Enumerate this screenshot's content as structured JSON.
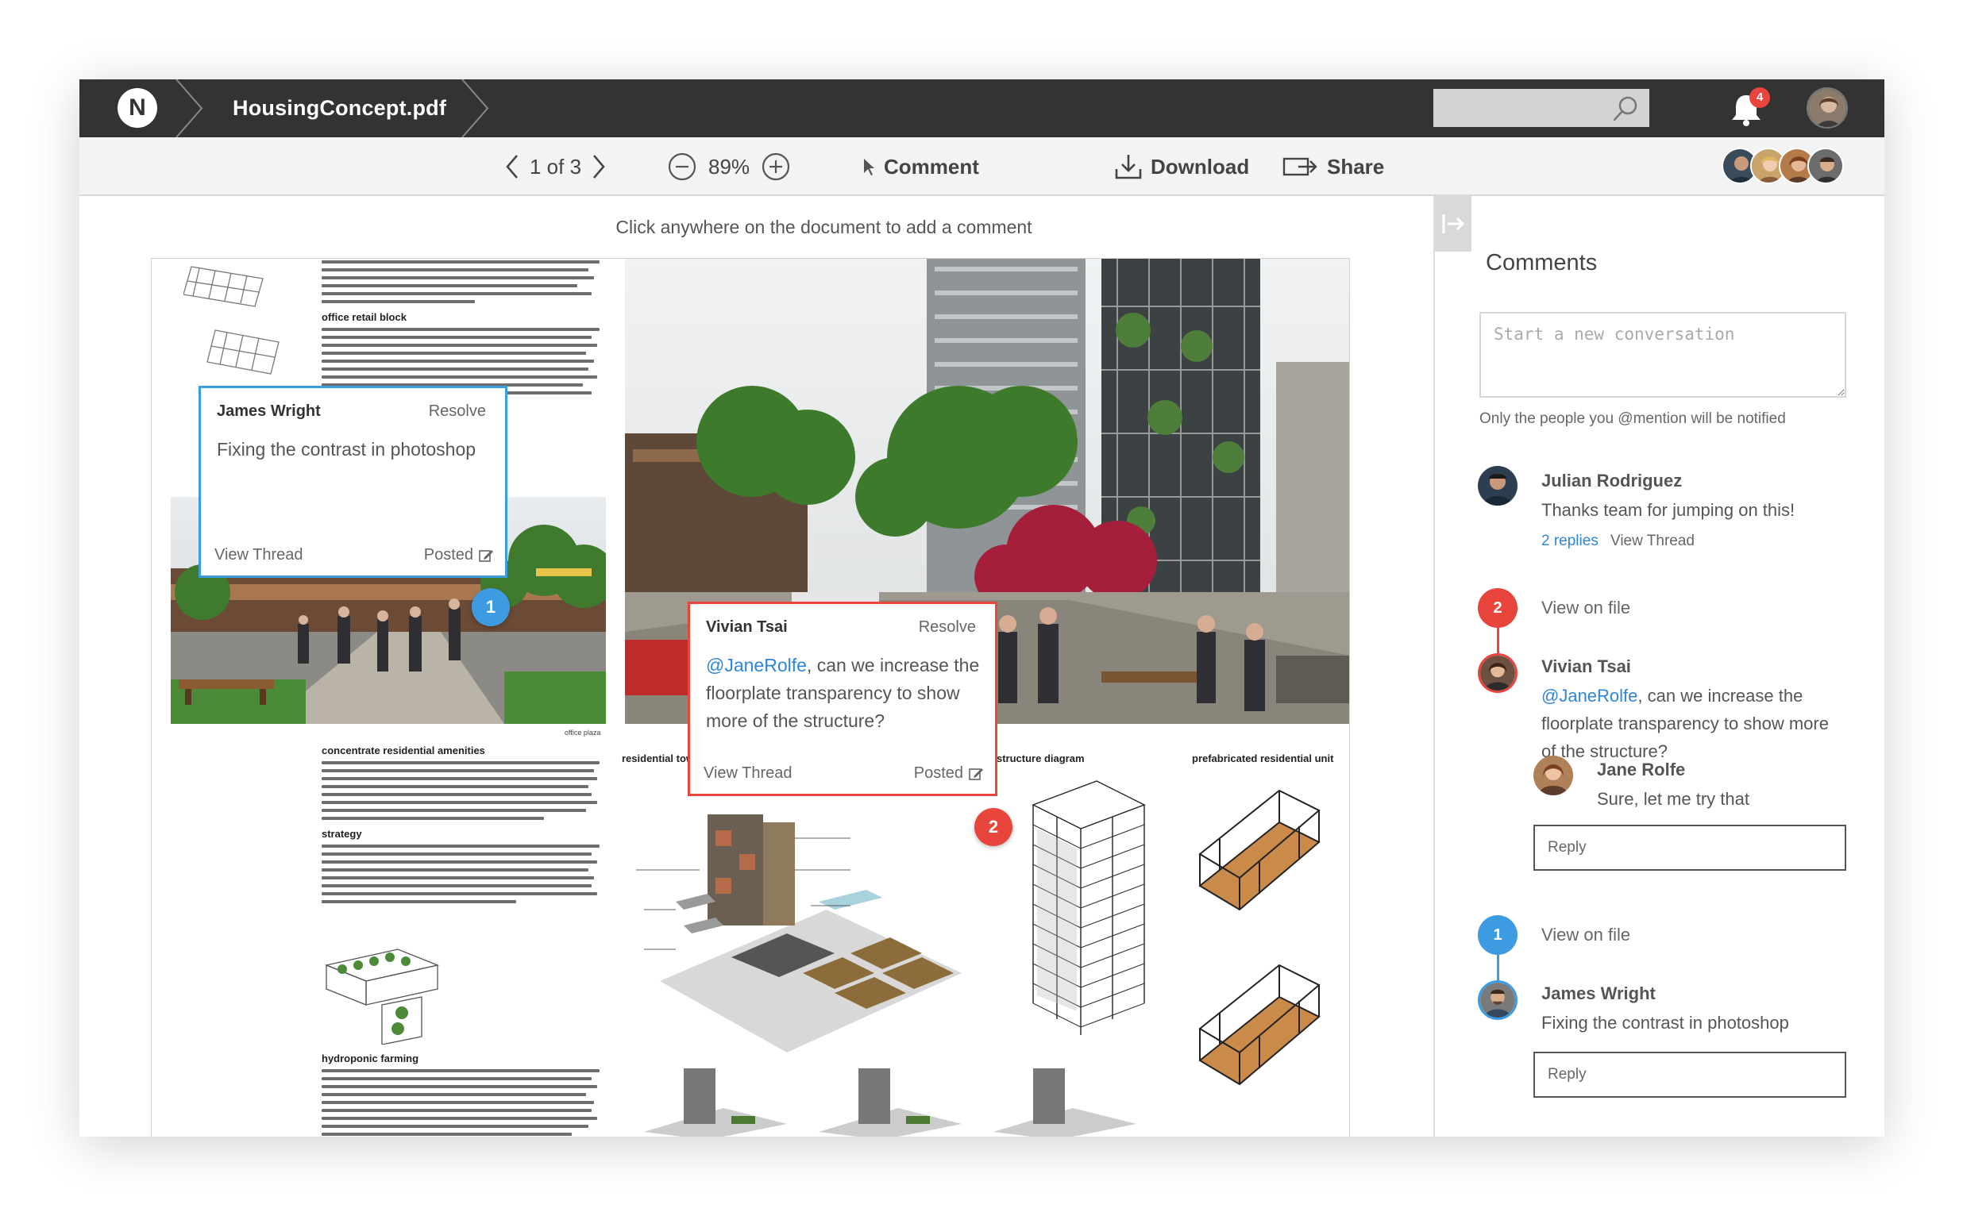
{
  "app": {
    "logo_letter": "N",
    "filename": "HousingConcept.pdf",
    "notification_count": "4"
  },
  "toolbar": {
    "page_indicator": "1 of 3",
    "zoom": "89%",
    "comment_label": "Comment",
    "download_label": "Download",
    "share_label": "Share"
  },
  "document": {
    "hint": "Click anywhere on the document to add a comment",
    "headings": {
      "office_retail": "office retail block",
      "concentrate": "concentrate residential amenities",
      "strategy": "strategy",
      "hydroponic": "hydroponic farming",
      "residential_tower": "residential tow",
      "structure_diagram": "structure diagram",
      "prefab_unit": "prefabricated residential unit",
      "office_plaza": "office plaza"
    }
  },
  "popovers": [
    {
      "author": "James Wright",
      "resolve": "Resolve",
      "body": "Fixing the contrast in photoshop",
      "view_thread": "View Thread",
      "posted": "Posted",
      "pin": "1"
    },
    {
      "author": "Vivian Tsai",
      "resolve": "Resolve",
      "mention": "@JaneRolfe",
      "body_rest": ", can we increase the floorplate transparency to show more of the structure?",
      "view_thread": "View Thread",
      "posted": "Posted",
      "pin": "2"
    }
  ],
  "side_panel": {
    "title": "Comments",
    "new_conversation_placeholder": "Start a new conversation",
    "notify_note": "Only the people you @mention will be notified",
    "threads": [
      {
        "author": "Julian Rodriguez",
        "message": "Thanks team for jumping on this!",
        "replies": "2 replies",
        "view_thread": "View Thread"
      },
      {
        "badge": "2",
        "view_on_file": "View on file",
        "author": "Vivian Tsai",
        "mention": "@JaneRolfe",
        "message_rest": ", can we increase the floorplate transparency to show more of the structure?",
        "reply_author": "Jane Rolfe",
        "reply_message": "Sure, let me try that",
        "reply_placeholder": "Reply"
      },
      {
        "badge": "1",
        "view_on_file": "View on file",
        "author": "James Wright",
        "message": "Fixing the contrast in photoshop",
        "reply_placeholder": "Reply"
      }
    ]
  },
  "colors": {
    "topbar": "#333333",
    "accent_blue": "#3d9be2",
    "accent_red": "#e8453c",
    "link": "#2f86d8"
  }
}
